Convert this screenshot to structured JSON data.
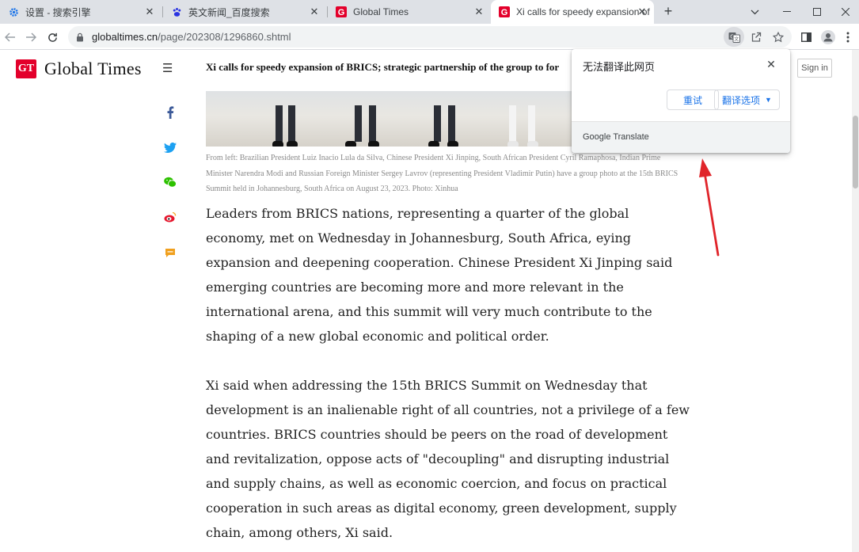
{
  "browser": {
    "tabs": [
      {
        "title": "设置 - 搜索引擎",
        "favicon": "gear-icon"
      },
      {
        "title": "英文新闻_百度搜索",
        "favicon": "baidu-paw-icon"
      },
      {
        "title": "Global Times",
        "favicon": "gt-g-icon"
      },
      {
        "title": "Xi calls for speedy expansion of",
        "favicon": "gt-g-icon",
        "active": true
      }
    ],
    "url_host": "globaltimes.cn",
    "url_path": "/page/202308/1296860.shtml"
  },
  "site": {
    "logo_badge": "GT",
    "logo_name": "Global Times",
    "headline": "Xi calls for speedy expansion of BRICS; strategic partnership of the group to for",
    "sign_in": "Sign in"
  },
  "article": {
    "caption": "From left: Brazilian President Luiz Inacio Lula da Silva, Chinese President Xi Jinping, South African President Cyril Ramaphosa, Indian Prime Minister Narendra Modi and Russian Foreign Minister Sergey Lavrov (representing President Vladimir Putin) have a group photo at the 15th BRICS Summit held in Johannesburg, South Africa on August 23, 2023. Photo: Xinhua",
    "paragraphs": [
      "Leaders from BRICS nations, representing a quarter of the global economy, met on Wednesday in Johannesburg, South Africa, eying expansion and deepening cooperation. Chinese President Xi Jinping said emerging countries are becoming more and more relevant in the international arena, and this summit will very much contribute to the shaping of a new global economic and political order.",
      "Xi said when addressing the 15th BRICS Summit on Wednesday that development is an inalienable right of all countries, not a privilege of a few countries. BRICS countries should be peers on the road of development and revitalization, oppose acts of \"decoupling\" and disrupting industrial and supply chains, as well as economic coercion, and focus on practical cooperation in such areas as digital economy, green development, supply chain, among others, Xi said."
    ]
  },
  "translate_popup": {
    "title": "无法翻译此网页",
    "retry": "重试",
    "options": "翻译选项",
    "footer": "Google Translate"
  },
  "colors": {
    "gt_red": "#e3002b",
    "chrome_blue": "#1a73e8",
    "annotation_arrow": "#e0242a"
  }
}
